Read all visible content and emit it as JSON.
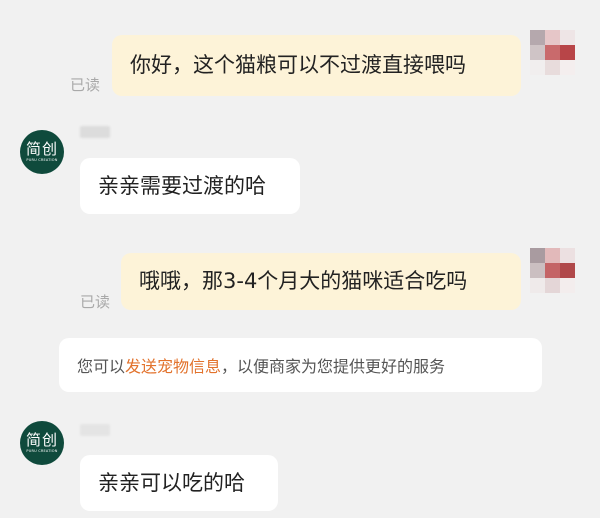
{
  "messages": {
    "m1": {
      "text": "你好，这个猫粮可以不过渡直接喂吗",
      "status": "已读"
    },
    "m2": {
      "text": "亲亲需要过渡的哈"
    },
    "m3": {
      "text": "哦哦，那3-4个月大的猫咪适合吃吗",
      "status": "已读"
    },
    "m4": {
      "text": "亲亲可以吃的哈"
    }
  },
  "system_tip": {
    "prefix": "您可以",
    "link": "发送宠物信息",
    "suffix": "，以便商家为您提供更好的服务"
  },
  "seller_avatar": {
    "logo": "简创",
    "sub": "PURU CREATION"
  },
  "colors": {
    "background": "#f1f1f1",
    "outgoing_bubble": "#fdf3d8",
    "incoming_bubble": "#ffffff",
    "link": "#e2722c",
    "avatar_bg": "#0f4a3c"
  }
}
